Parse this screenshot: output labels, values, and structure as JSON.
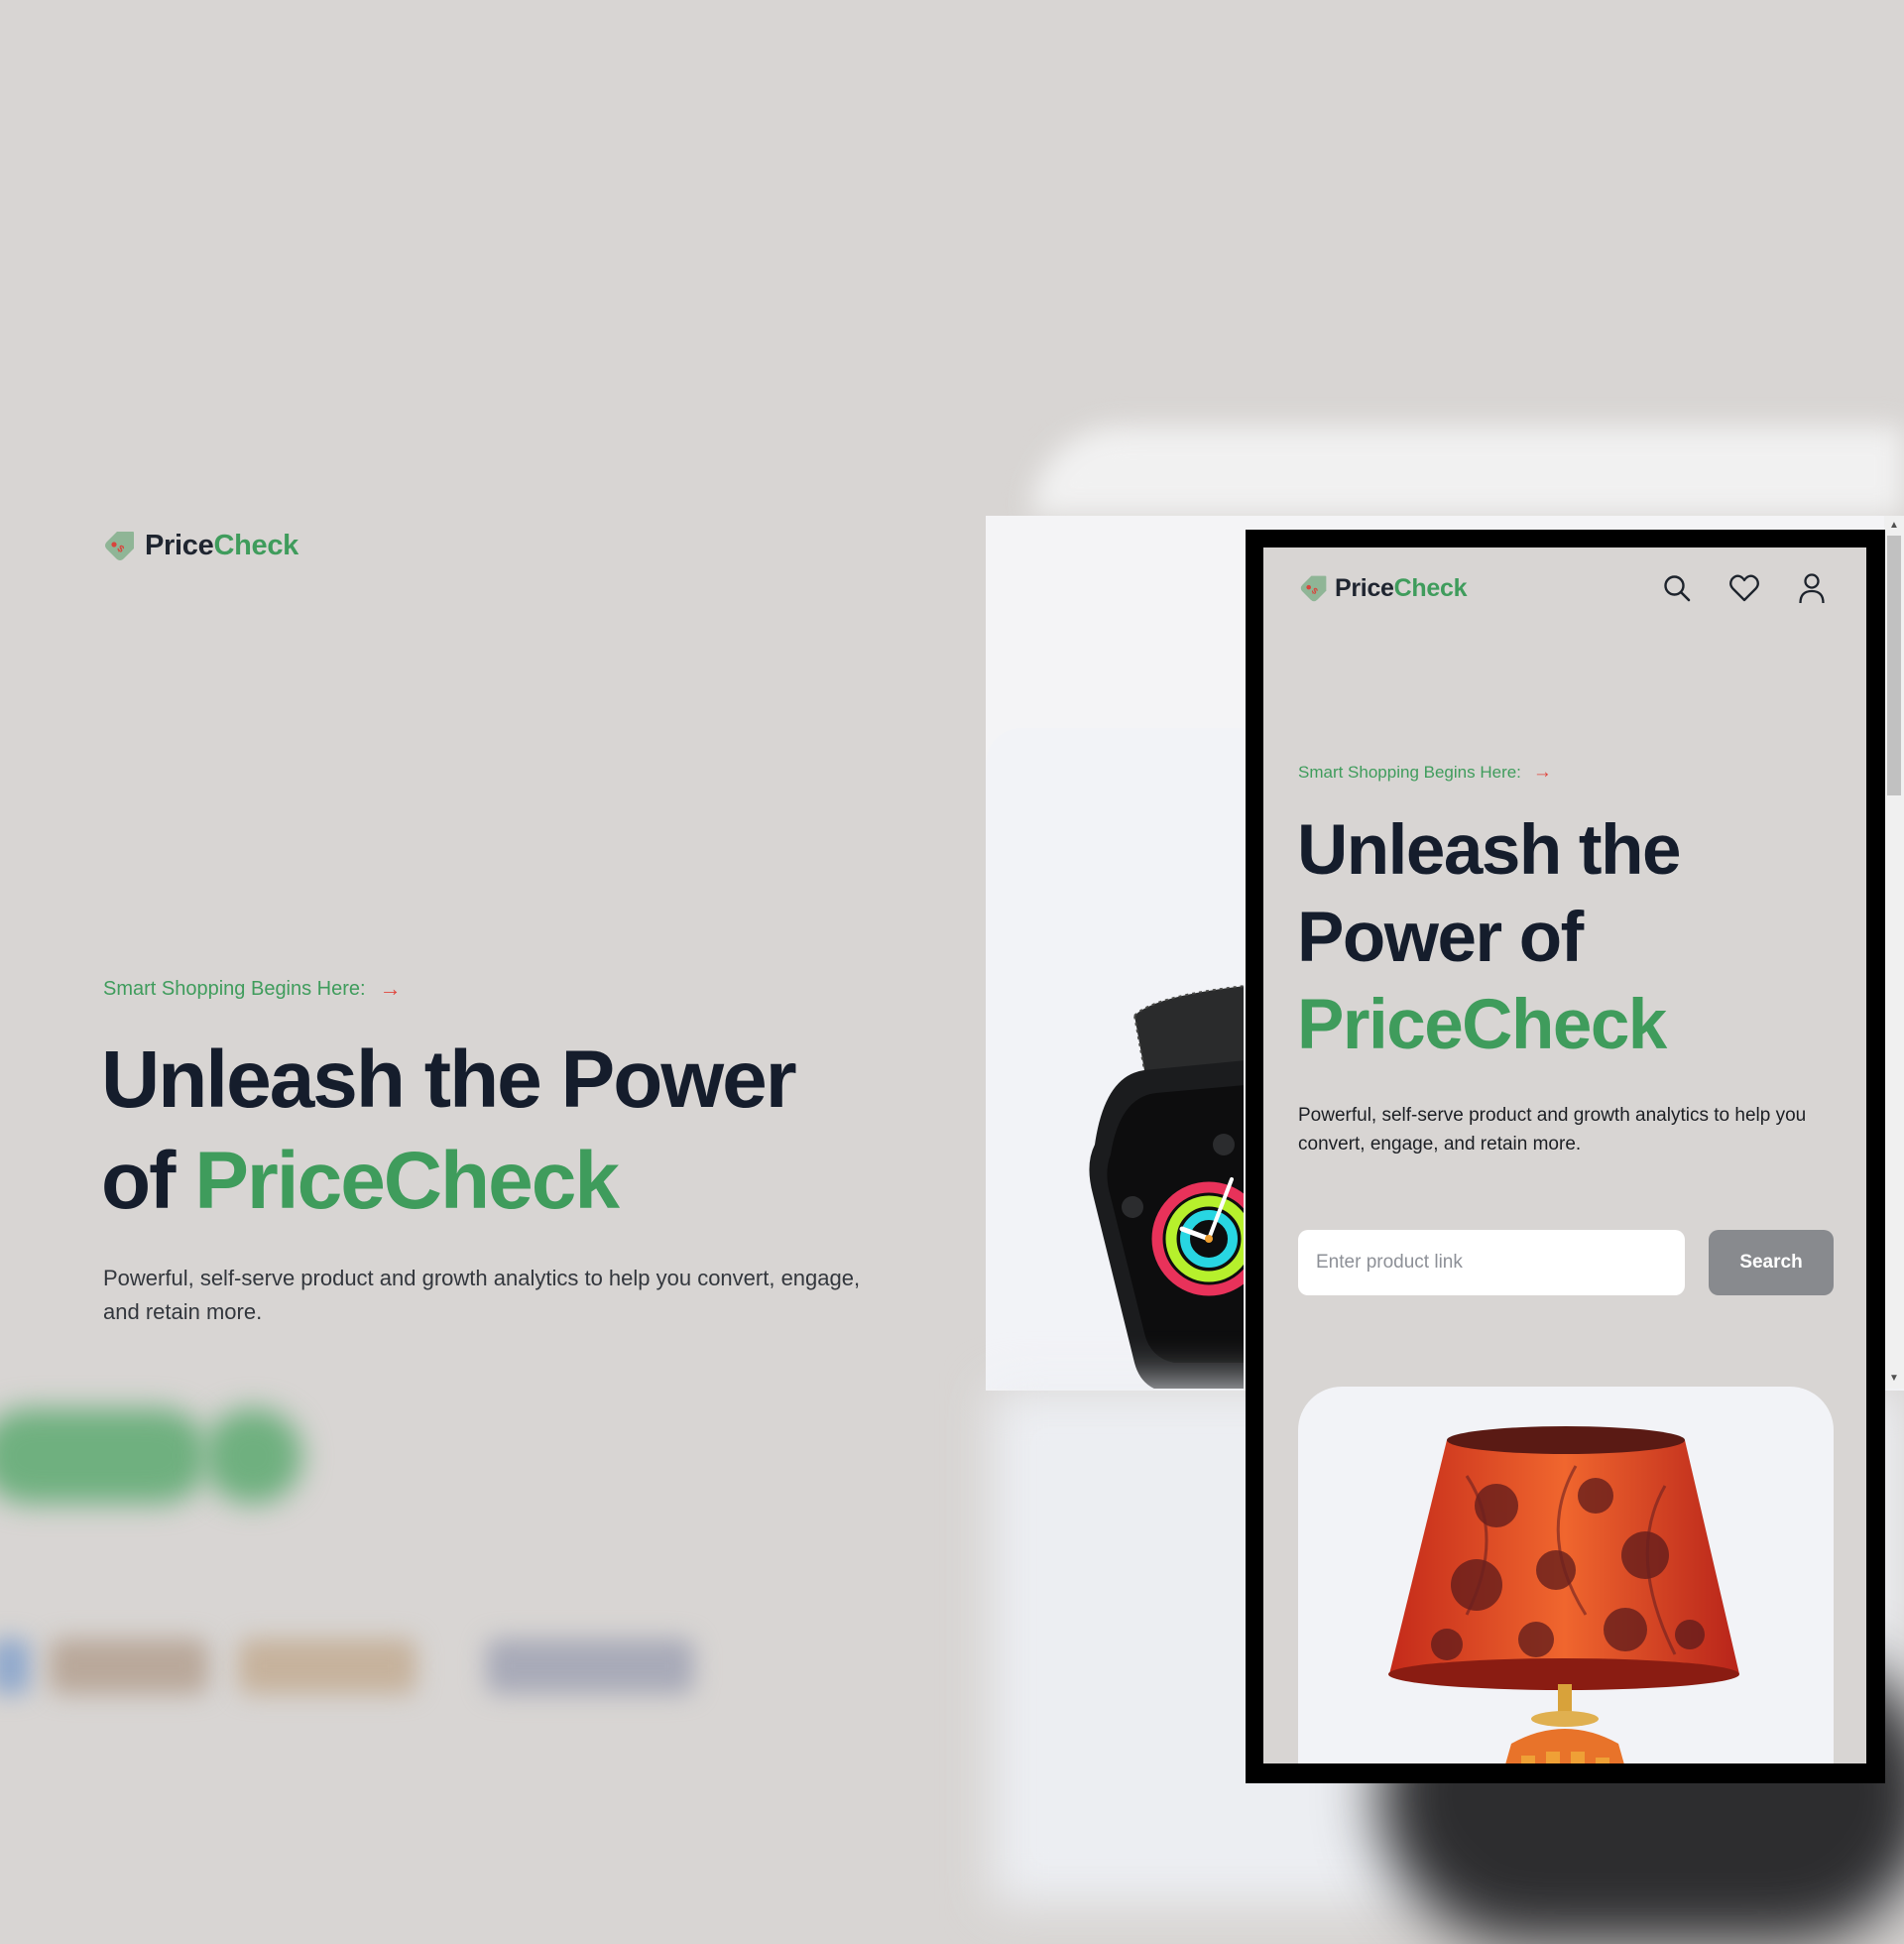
{
  "brand": {
    "name_part1": "Price",
    "name_part2": "Check",
    "accent_color": "#3f9c5c",
    "dark_text_color": "#151d2c",
    "arrow_color": "#e0453d",
    "logo_icon": "price-tag-icon"
  },
  "desktop": {
    "eyebrow": "Smart Shopping Begins Here:",
    "title_line1": "Unleash the Power",
    "title_of": "of",
    "title_brand": "PriceCheck",
    "description": "Powerful, self-serve product and growth analytics to help you convert, engage, and retain more."
  },
  "mobile": {
    "header_icons": [
      "search-icon",
      "heart-icon",
      "user-icon"
    ],
    "eyebrow": "Smart Shopping Begins Here:",
    "title_line1": "Unleash the",
    "title_line2": "Power of",
    "title_brand": "PriceCheck",
    "description": "Powerful, self-serve product and growth analytics to help you convert, engage, and retain more.",
    "search": {
      "placeholder": "Enter product link",
      "button_label": "Search"
    }
  }
}
